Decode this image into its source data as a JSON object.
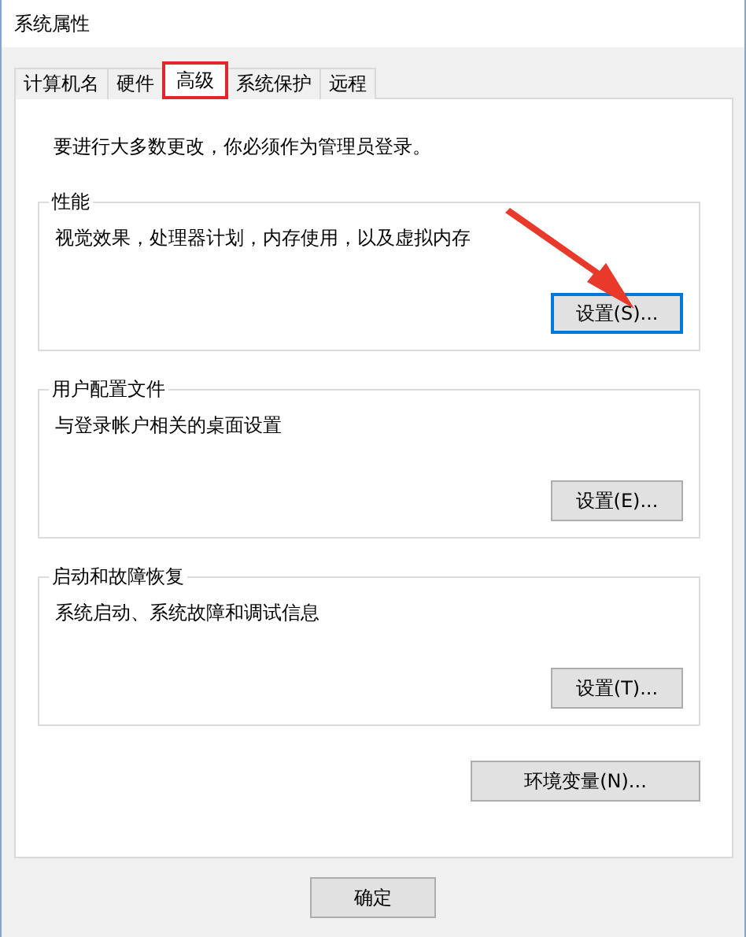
{
  "window": {
    "title": "系统属性"
  },
  "tabs": [
    {
      "label": "计算机名",
      "selected": false,
      "highlighted": false
    },
    {
      "label": "硬件",
      "selected": false,
      "highlighted": false
    },
    {
      "label": "高级",
      "selected": true,
      "highlighted": true
    },
    {
      "label": "系统保护",
      "selected": false,
      "highlighted": false
    },
    {
      "label": "远程",
      "selected": false,
      "highlighted": false
    }
  ],
  "notice": "要进行大多数更改，你必须作为管理员登录。",
  "groups": [
    {
      "title": "性能",
      "description": "视觉效果，处理器计划，内存使用，以及虚拟内存",
      "button": "设置(S)...",
      "focused": true,
      "pointer_arrow": true
    },
    {
      "title": "用户配置文件",
      "description": "与登录帐户相关的桌面设置",
      "button": "设置(E)...",
      "focused": false,
      "pointer_arrow": false
    },
    {
      "title": "启动和故障恢复",
      "description": "系统启动、系统故障和调试信息",
      "button": "设置(T)...",
      "focused": false,
      "pointer_arrow": false
    }
  ],
  "env_button": "环境变量(N)...",
  "footer_buttons": [
    "确定"
  ]
}
